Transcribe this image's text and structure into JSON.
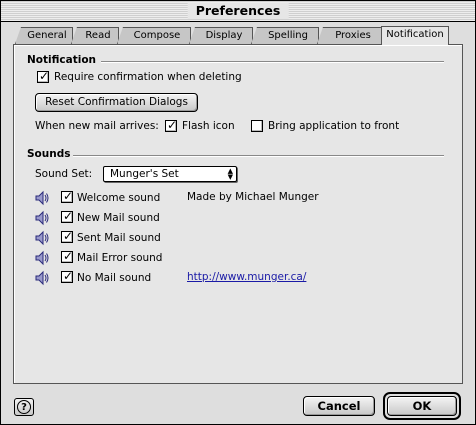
{
  "window": {
    "title": "Preferences"
  },
  "tabs": [
    {
      "label": "General"
    },
    {
      "label": "Read"
    },
    {
      "label": "Compose"
    },
    {
      "label": "Display"
    },
    {
      "label": "Spelling"
    },
    {
      "label": "Proxies"
    },
    {
      "label": "Notification",
      "active": true
    }
  ],
  "notification": {
    "heading": "Notification",
    "require_confirm_label": "Require confirmation when deleting",
    "require_confirm_checked": true,
    "reset_button_label": "Reset Confirmation Dialogs",
    "new_mail_label": "When new mail arrives:",
    "flash_icon_label": "Flash icon",
    "flash_icon_checked": true,
    "bring_front_label": "Bring application to front",
    "bring_front_checked": false
  },
  "sounds": {
    "heading": "Sounds",
    "sound_set_label": "Sound Set:",
    "sound_set_value": "Munger's Set",
    "credit": "Made by Michael Munger",
    "url": "http://www.munger.ca/",
    "items": [
      {
        "label": "Welcome sound",
        "checked": true
      },
      {
        "label": "New Mail sound",
        "checked": true
      },
      {
        "label": "Sent Mail sound",
        "checked": true
      },
      {
        "label": "Mail Error sound",
        "checked": true
      },
      {
        "label": "No Mail sound",
        "checked": true
      }
    ]
  },
  "footer": {
    "help_icon": "question-mark-icon",
    "cancel_label": "Cancel",
    "ok_label": "OK"
  }
}
